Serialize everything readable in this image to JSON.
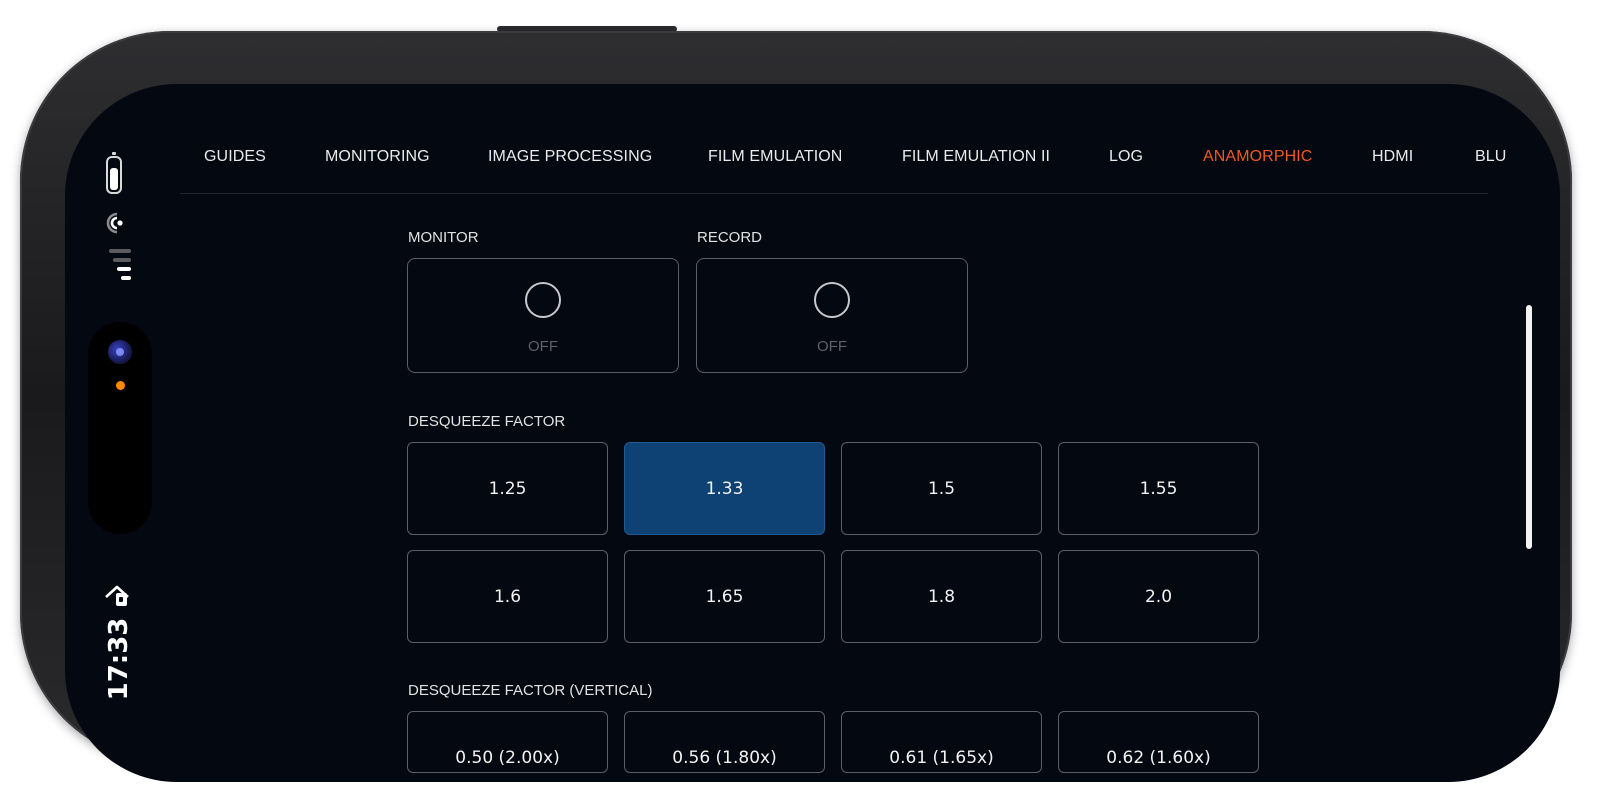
{
  "status": {
    "time": "17:33"
  },
  "tabs": [
    {
      "label": "GUIDES",
      "active": false
    },
    {
      "label": "MONITORING",
      "active": false
    },
    {
      "label": "IMAGE PROCESSING",
      "active": false
    },
    {
      "label": "FILM EMULATION",
      "active": false
    },
    {
      "label": "FILM EMULATION II",
      "active": false
    },
    {
      "label": "LOG",
      "active": false
    },
    {
      "label": "ANAMORPHIC",
      "active": true
    },
    {
      "label": "HDMI",
      "active": false
    },
    {
      "label": "BLU",
      "active": false
    }
  ],
  "monitor": {
    "label": "MONITOR",
    "state": "OFF"
  },
  "record": {
    "label": "RECORD",
    "state": "OFF"
  },
  "desqueeze": {
    "label": "DESQUEEZE FACTOR",
    "options": [
      "1.25",
      "1.33",
      "1.5",
      "1.55",
      "1.6",
      "1.65",
      "1.8",
      "2.0"
    ],
    "selected": "1.33"
  },
  "desqueeze_vertical": {
    "label": "DESQUEEZE FACTOR (VERTICAL)",
    "options": [
      "0.50 (2.00x)",
      "0.56 (1.80x)",
      "0.61 (1.65x)",
      "0.62 (1.60x)"
    ]
  },
  "colors": {
    "accent_active_tab": "#ef5a24",
    "selected_button": "#0f4274",
    "background": "#040810"
  }
}
